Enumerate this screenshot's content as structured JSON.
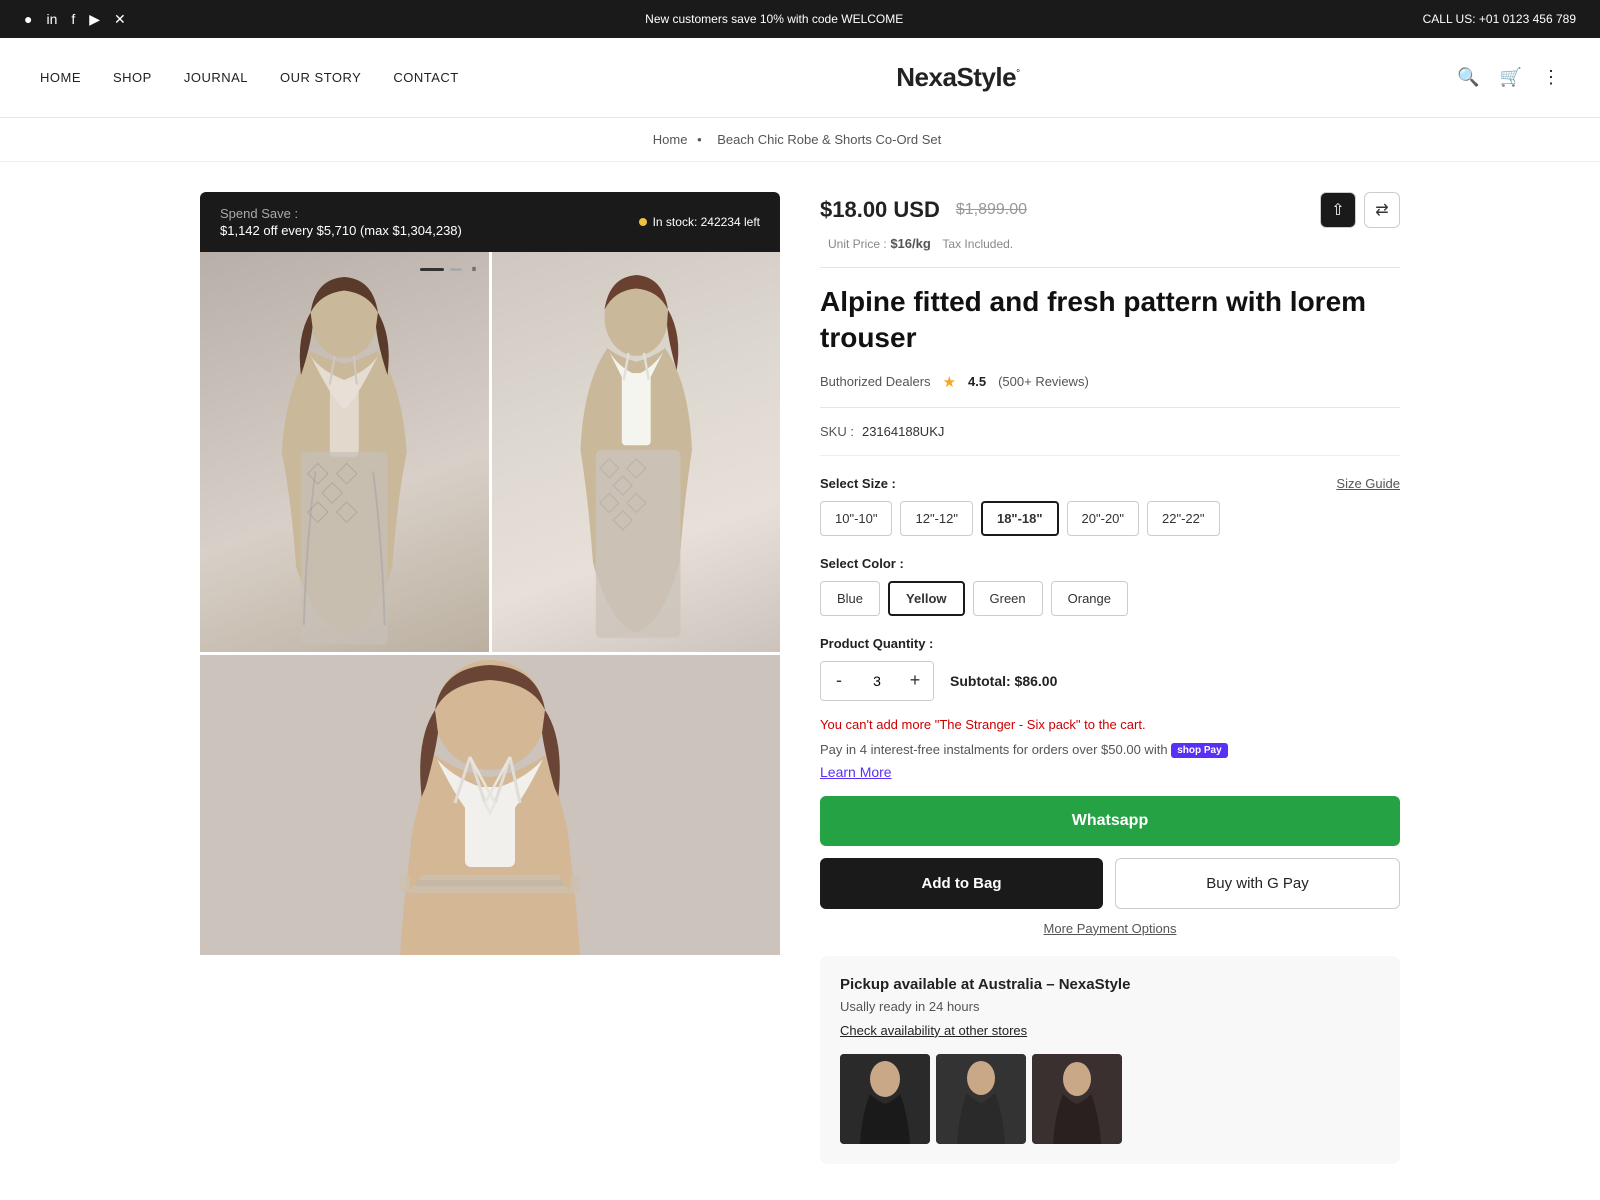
{
  "topbar": {
    "promo": "New customers save 10% with code WELCOME",
    "call_label": "CALL US:",
    "phone": "+01 0123 456 789",
    "icons": [
      "instagram",
      "linkedin",
      "facebook",
      "youtube",
      "x-twitter"
    ]
  },
  "nav": {
    "links": [
      "HOME",
      "SHOP",
      "JOURNAL",
      "OUR STORY",
      "CONTACT"
    ],
    "logo": "NexaStyle",
    "logo_symbol": "°"
  },
  "breadcrumb": {
    "home": "Home",
    "separator": "•",
    "current": "Beach Chic Robe & Shorts Co-Ord Set"
  },
  "spend_save": {
    "label": "Spend Save :",
    "detail": "$1,142 off every $5,710 (max $1,304,238)"
  },
  "stock": {
    "label": "In stock: 242234 left"
  },
  "product": {
    "current_price": "$18.00 USD",
    "original_price": "$1,899.00",
    "unit_price_label": "Unit Price :",
    "unit_price_value": "$16/kg",
    "tax_label": "Tax Included.",
    "title": "Alpine fitted and fresh pattern with lorem trouser",
    "dealers_label": "Buthorized Dealers",
    "rating": "4.5",
    "reviews": "(500+ Reviews)",
    "sku_label": "SKU :",
    "sku_value": "23164188UKJ",
    "select_size_label": "Select Size :",
    "size_guide_label": "Size Guide",
    "sizes": [
      "10\"-10\"",
      "12\"-12\"",
      "18\"-18\"",
      "20\"-20\"",
      "22\"-22\""
    ],
    "active_size": "18\"-18\"",
    "select_color_label": "Select Color :",
    "colors": [
      "Blue",
      "Yellow",
      "Green",
      "Orange"
    ],
    "active_color": "Yellow",
    "quantity_label": "Product Quantity :",
    "quantity": 3,
    "qty_minus": "-",
    "qty_plus": "+",
    "subtotal_label": "Subtotal:",
    "subtotal_value": "$86.00",
    "cart_error": "You can't add more \"The Stranger - Six pack\" to the cart.",
    "shopify_pay_text": "Pay in 4 interest-free instalments for orders over $50.00 with",
    "shopify_pay_badge": "shop Pay",
    "learn_more": "Learn More",
    "whatsapp_label": "Whatsapp",
    "add_to_bag_label": "Add to Bag",
    "buy_gpay_label": "Buy with G Pay",
    "more_payment_label": "More Payment Options",
    "pickup_title": "Pickup available at Australia  – NexaStyle",
    "pickup_subtitle": "Usally ready in 24 hours",
    "check_availability": "Check availability at other stores"
  }
}
